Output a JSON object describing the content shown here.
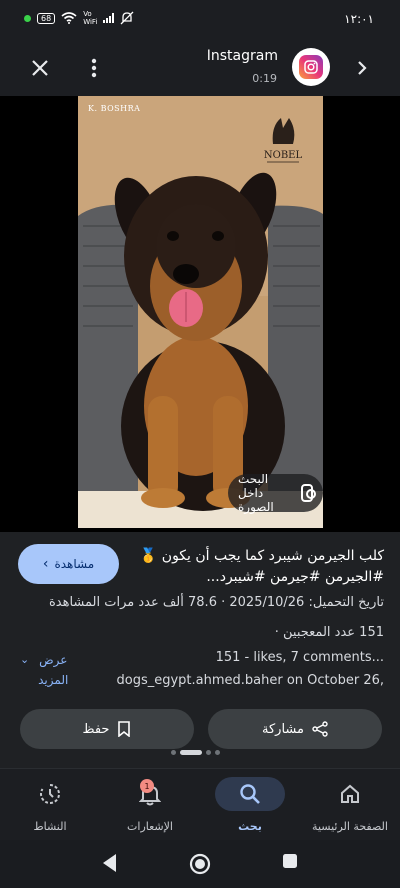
{
  "status_bar": {
    "time": "١٢:٠١",
    "battery": "68",
    "network_top": "Vo",
    "network_bottom": "WiFi"
  },
  "header": {
    "app_name": "Instagram",
    "elapsed": "0:19",
    "icons": [
      "close-icon",
      "more-vert-icon",
      "instagram-logo",
      "chevron-right-icon"
    ]
  },
  "image": {
    "watermark_left": "K. BOSHRA",
    "lens_label": "البحث داخل الصورة"
  },
  "info": {
    "visit_label": "مشاهدة",
    "caption": "كلب الجيرمن شيبرد كما يجب أن يكون 🥇#الجيرمن #جيرمن #شيبرد...",
    "upload_date": "تاريخ التحميل: 2025/10/26",
    "views": "78.6 ألف عدد مرات المشاهدة",
    "likes": "151 عدد المعجبين",
    "instagram_line1": "151 - likes, 7 comments...",
    "instagram_line2": "dogs_egypt.ahmed.baher on October 26,",
    "show_more": "عرض المزيد",
    "save_label": "حفظ",
    "share_label": "مشاركة"
  },
  "bottom_nav": {
    "items": [
      {
        "label": "الصفحة الرئيسية",
        "icon": "home-icon"
      },
      {
        "label": "بحث",
        "icon": "search-icon"
      },
      {
        "label": "الإشعارات",
        "icon": "bell-icon",
        "badge": "1"
      },
      {
        "label": "النشاط",
        "icon": "activity-icon"
      }
    ]
  },
  "colors": {
    "accent": "#a8c7fa",
    "surface": "#1f2124",
    "background": "#1a1c20"
  }
}
